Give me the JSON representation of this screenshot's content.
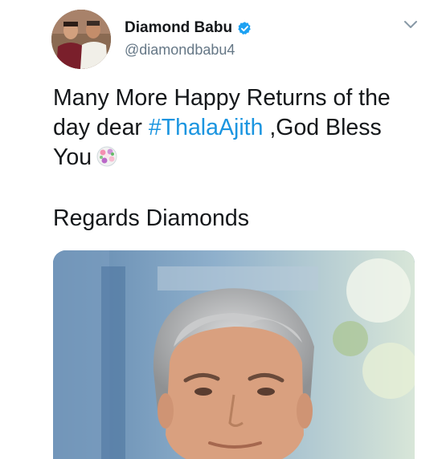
{
  "tweet": {
    "user": {
      "display_name": "Diamond Babu",
      "handle": "@diamondbabu4",
      "verified": true
    },
    "text": {
      "part1": "Many More Happy Returns of the day dear ",
      "hashtag": "#ThalaAjith",
      "part2": " ,God Bless You"
    },
    "regards": "Regards Diamonds",
    "icons": {
      "avatar": "profile-photo",
      "verified": "verified-badge-icon",
      "menu": "chevron-down-icon",
      "emoji": "flower-bouquet-emoji"
    },
    "colors": {
      "hashtag": "#1b95e0",
      "verified": "#1da1f2",
      "handle": "#657786"
    }
  }
}
